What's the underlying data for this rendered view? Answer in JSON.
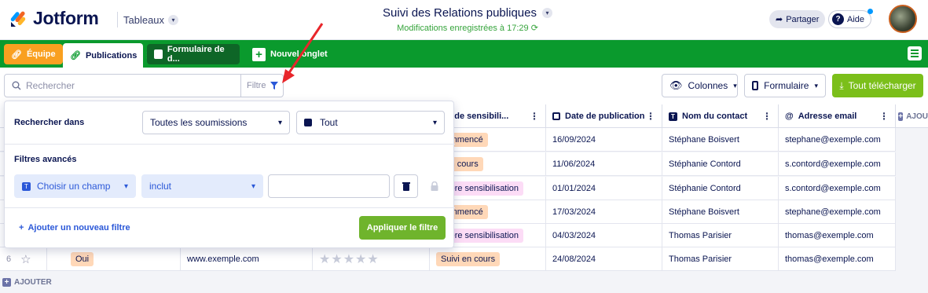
{
  "app": {
    "name": "Jotform",
    "tables_menu": "Tableaux",
    "brand_color": "#f26522"
  },
  "header": {
    "title": "Suivi des Relations publiques",
    "saved_status": "Modifications enregistrées à 17:29",
    "share_label": "Partager",
    "help_label": "Aide"
  },
  "tabs": [
    {
      "label": "Équipe",
      "icon": "link-icon"
    },
    {
      "label": "Publications",
      "icon": "link-icon"
    },
    {
      "label": "Formulaire de d...",
      "icon": "form-icon"
    },
    {
      "label": "Nouvel onglet",
      "icon": "plus-icon"
    }
  ],
  "toolbar": {
    "search_placeholder": "Rechercher",
    "filter_label": "Filtre",
    "columns_label": "Colonnes",
    "form_label": "Formulaire",
    "download_label": "Tout télécharger"
  },
  "filter_panel": {
    "search_in_label": "Rechercher dans",
    "search_in_value": "Toutes les soumissions",
    "scope_value": "Tout",
    "advanced_label": "Filtres avancés",
    "field_placeholder": "Choisir un champ",
    "operator_value": "inclut",
    "value_input": "",
    "add_filter_label": "Ajouter un nouveau filtre",
    "apply_label": "Appliquer le filtre"
  },
  "table": {
    "columns": [
      "atut de sensibili...",
      "Date de publication",
      "Nom du contact",
      "Adresse email"
    ],
    "add_column_label": "AJOU",
    "add_row_label": "AJOUTER",
    "rows": [
      {
        "status": "commencé",
        "status_color": "orange",
        "date": "16/09/2024",
        "contact": "Stéphane Boisvert",
        "email": "stephane@exemple.com"
      },
      {
        "status": "i en cours",
        "status_color": "orange",
        "date": "11/06/2024",
        "contact": "Stéphanie Contord",
        "email": "s.contord@exemple.com"
      },
      {
        "status": "mière sensibilisation",
        "status_color": "pink",
        "date": "01/01/2024",
        "contact": "Stéphanie Contord",
        "email": "s.contord@exemple.com"
      },
      {
        "status": "commencé",
        "status_color": "orange",
        "date": "17/03/2024",
        "contact": "Stéphane Boisvert",
        "email": "stephane@exemple.com"
      },
      {
        "status": "mière sensibilisation",
        "status_color": "pink",
        "date": "04/03/2024",
        "contact": "Thomas Parisier",
        "email": "thomas@exemple.com"
      },
      {
        "status": "Suivi en cours",
        "status_color": "orange",
        "date": "24/08/2024",
        "contact": "Thomas Parisier",
        "email": "thomas@exemple.com"
      }
    ],
    "row6": {
      "num": "6",
      "answer": "Oui",
      "website": "www.exemple.com",
      "rating": 0
    }
  }
}
